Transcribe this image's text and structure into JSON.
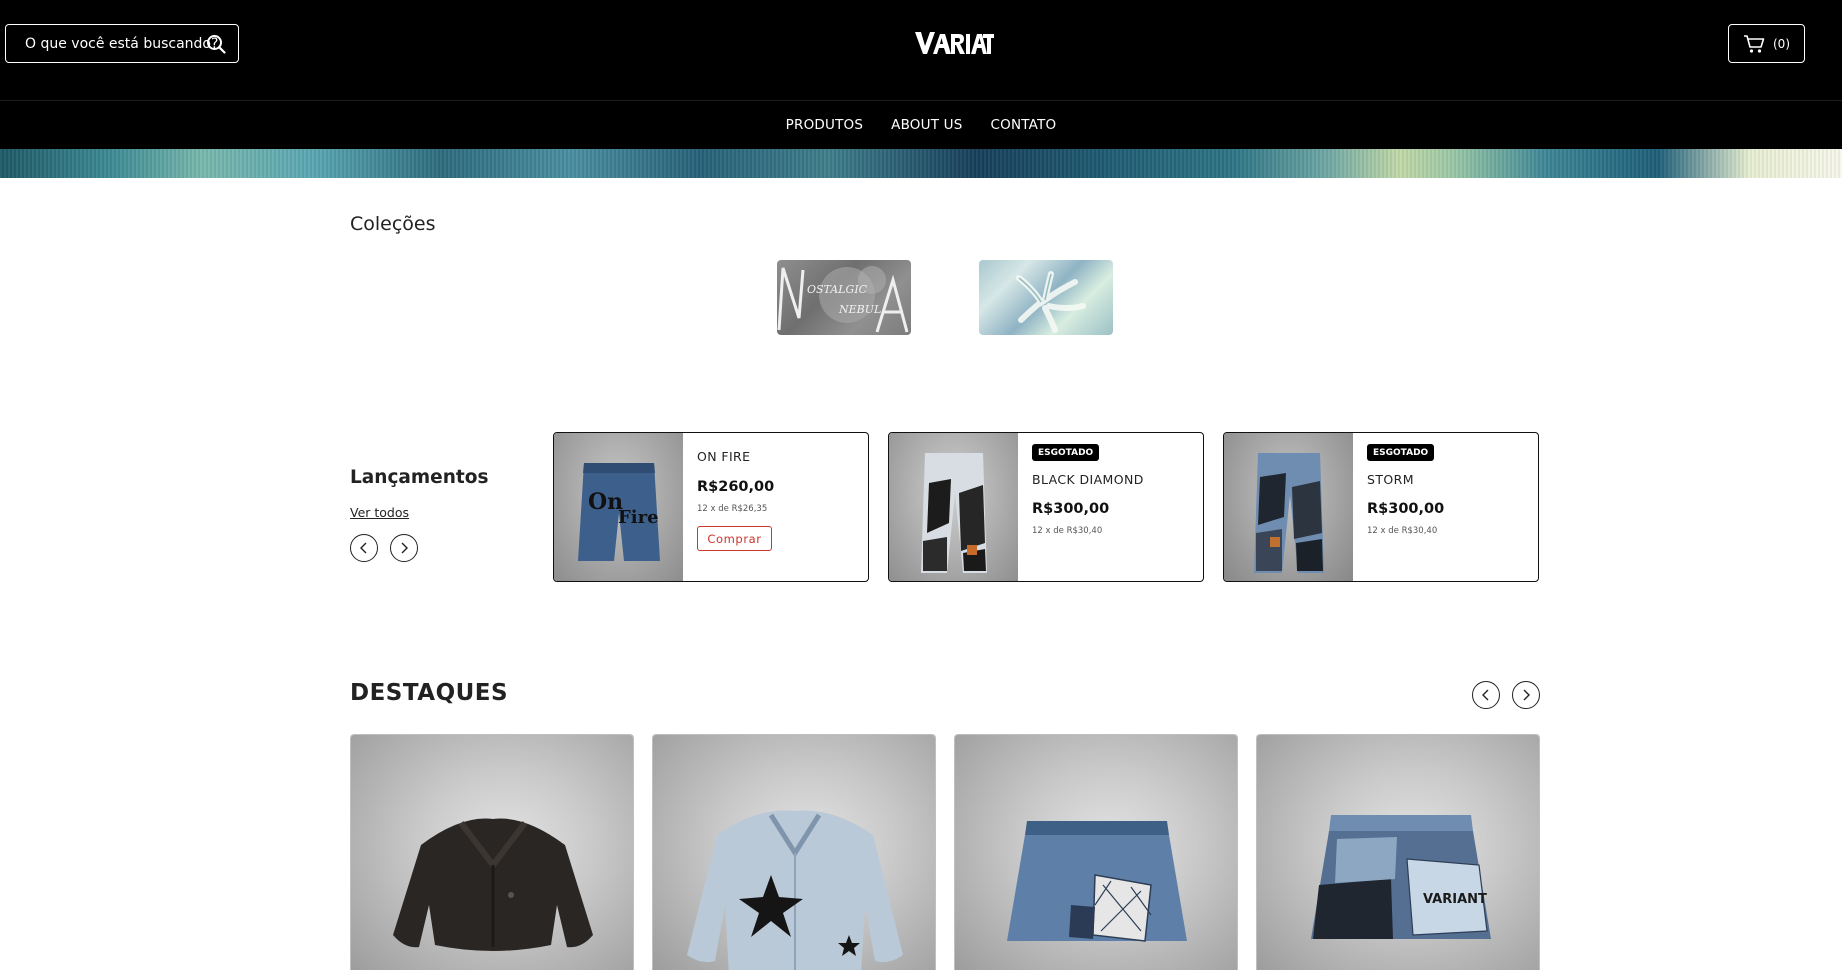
{
  "header": {
    "search_placeholder": "O que você está buscando?",
    "logo_text": "VARIANT",
    "cart_count": "(0)"
  },
  "nav": {
    "items": [
      {
        "label": "PRODUTOS"
      },
      {
        "label": "ABOUT US"
      },
      {
        "label": "CONTATO"
      }
    ]
  },
  "collections": {
    "title": "Coleções",
    "items": [
      {
        "name": "NOSTALGIC NEBULA"
      },
      {
        "name": "holographic"
      }
    ]
  },
  "releases": {
    "title": "Lançamentos",
    "see_all": "Ver todos",
    "products": [
      {
        "name": "ON FIRE",
        "price": "R$260,00",
        "installments": "12 x de R$26,35",
        "badge": "",
        "button": "Comprar"
      },
      {
        "name": "BLACK DIAMOND",
        "price": "R$300,00",
        "installments": "12 x de R$30,40",
        "badge": "ESGOTADO",
        "button": ""
      },
      {
        "name": "STORM",
        "price": "R$300,00",
        "installments": "12 x de R$30,40",
        "badge": "ESGOTADO",
        "button": ""
      }
    ]
  },
  "featured": {
    "title": "DESTAQUES",
    "items": [
      {
        "name": "black fur jacket"
      },
      {
        "name": "denim star jacket"
      },
      {
        "name": "patchwork denim mini skirt"
      },
      {
        "name": "variant denim mini skirt"
      }
    ]
  },
  "colors": {
    "header_bg": "#000000",
    "accent_red": "#c9362b",
    "text": "#111111"
  }
}
